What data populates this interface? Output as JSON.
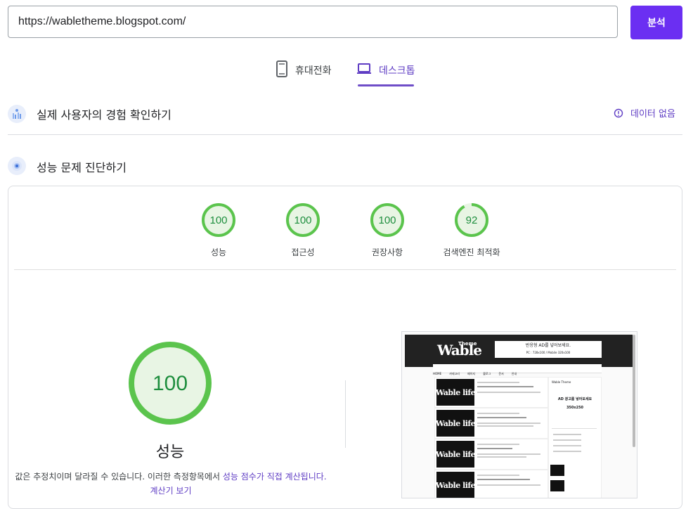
{
  "search": {
    "url": "https://wabletheme.blogspot.com/",
    "analyze_label": "분석"
  },
  "tabs": [
    {
      "label": "휴대전화",
      "icon": "mobile-icon",
      "selected": false
    },
    {
      "label": "데스크톱",
      "icon": "laptop-icon",
      "selected": true
    }
  ],
  "field_data": {
    "title": "실제 사용자의 경험 확인하기",
    "no_data_label": "데이터 없음"
  },
  "diagnostics": {
    "title": "성능 문제 진단하기"
  },
  "scores": [
    {
      "value": 100,
      "label": "성능"
    },
    {
      "value": 100,
      "label": "접근성"
    },
    {
      "value": 100,
      "label": "권장사항"
    },
    {
      "value": 92,
      "label": "검색엔진 최적화"
    }
  ],
  "main_score": {
    "value": 100,
    "label": "성능",
    "note_prefix": "값은 추정치이며 달라질 수 있습니다. 이러한 측정항목에서 ",
    "note_link": "성능 점수가 직접 계산됩니다.",
    "note_calc_link": "계산기 보기"
  },
  "colors": {
    "accent": "#6b2ff2",
    "pass_green": "#0cce6b",
    "gauge_stroke": "#5bc44d",
    "gauge_fill": "#e8f5e4"
  },
  "thumbnail": {
    "logo": "Wable",
    "logo_small": "Theme",
    "ad_line1": "반응형 AD를 넣어보세요.",
    "ad_line2": "PC : 728x100 / Mobile 320x100",
    "nav": [
      "HOME",
      "카테고리",
      "페이지",
      "블로그",
      "문서",
      "안내"
    ],
    "post_img_text": "Wable life",
    "side_title": "Wable Theme",
    "side_ad_line1": "AD 광고를 넣어보세요",
    "side_ad_line2": "350x250"
  }
}
